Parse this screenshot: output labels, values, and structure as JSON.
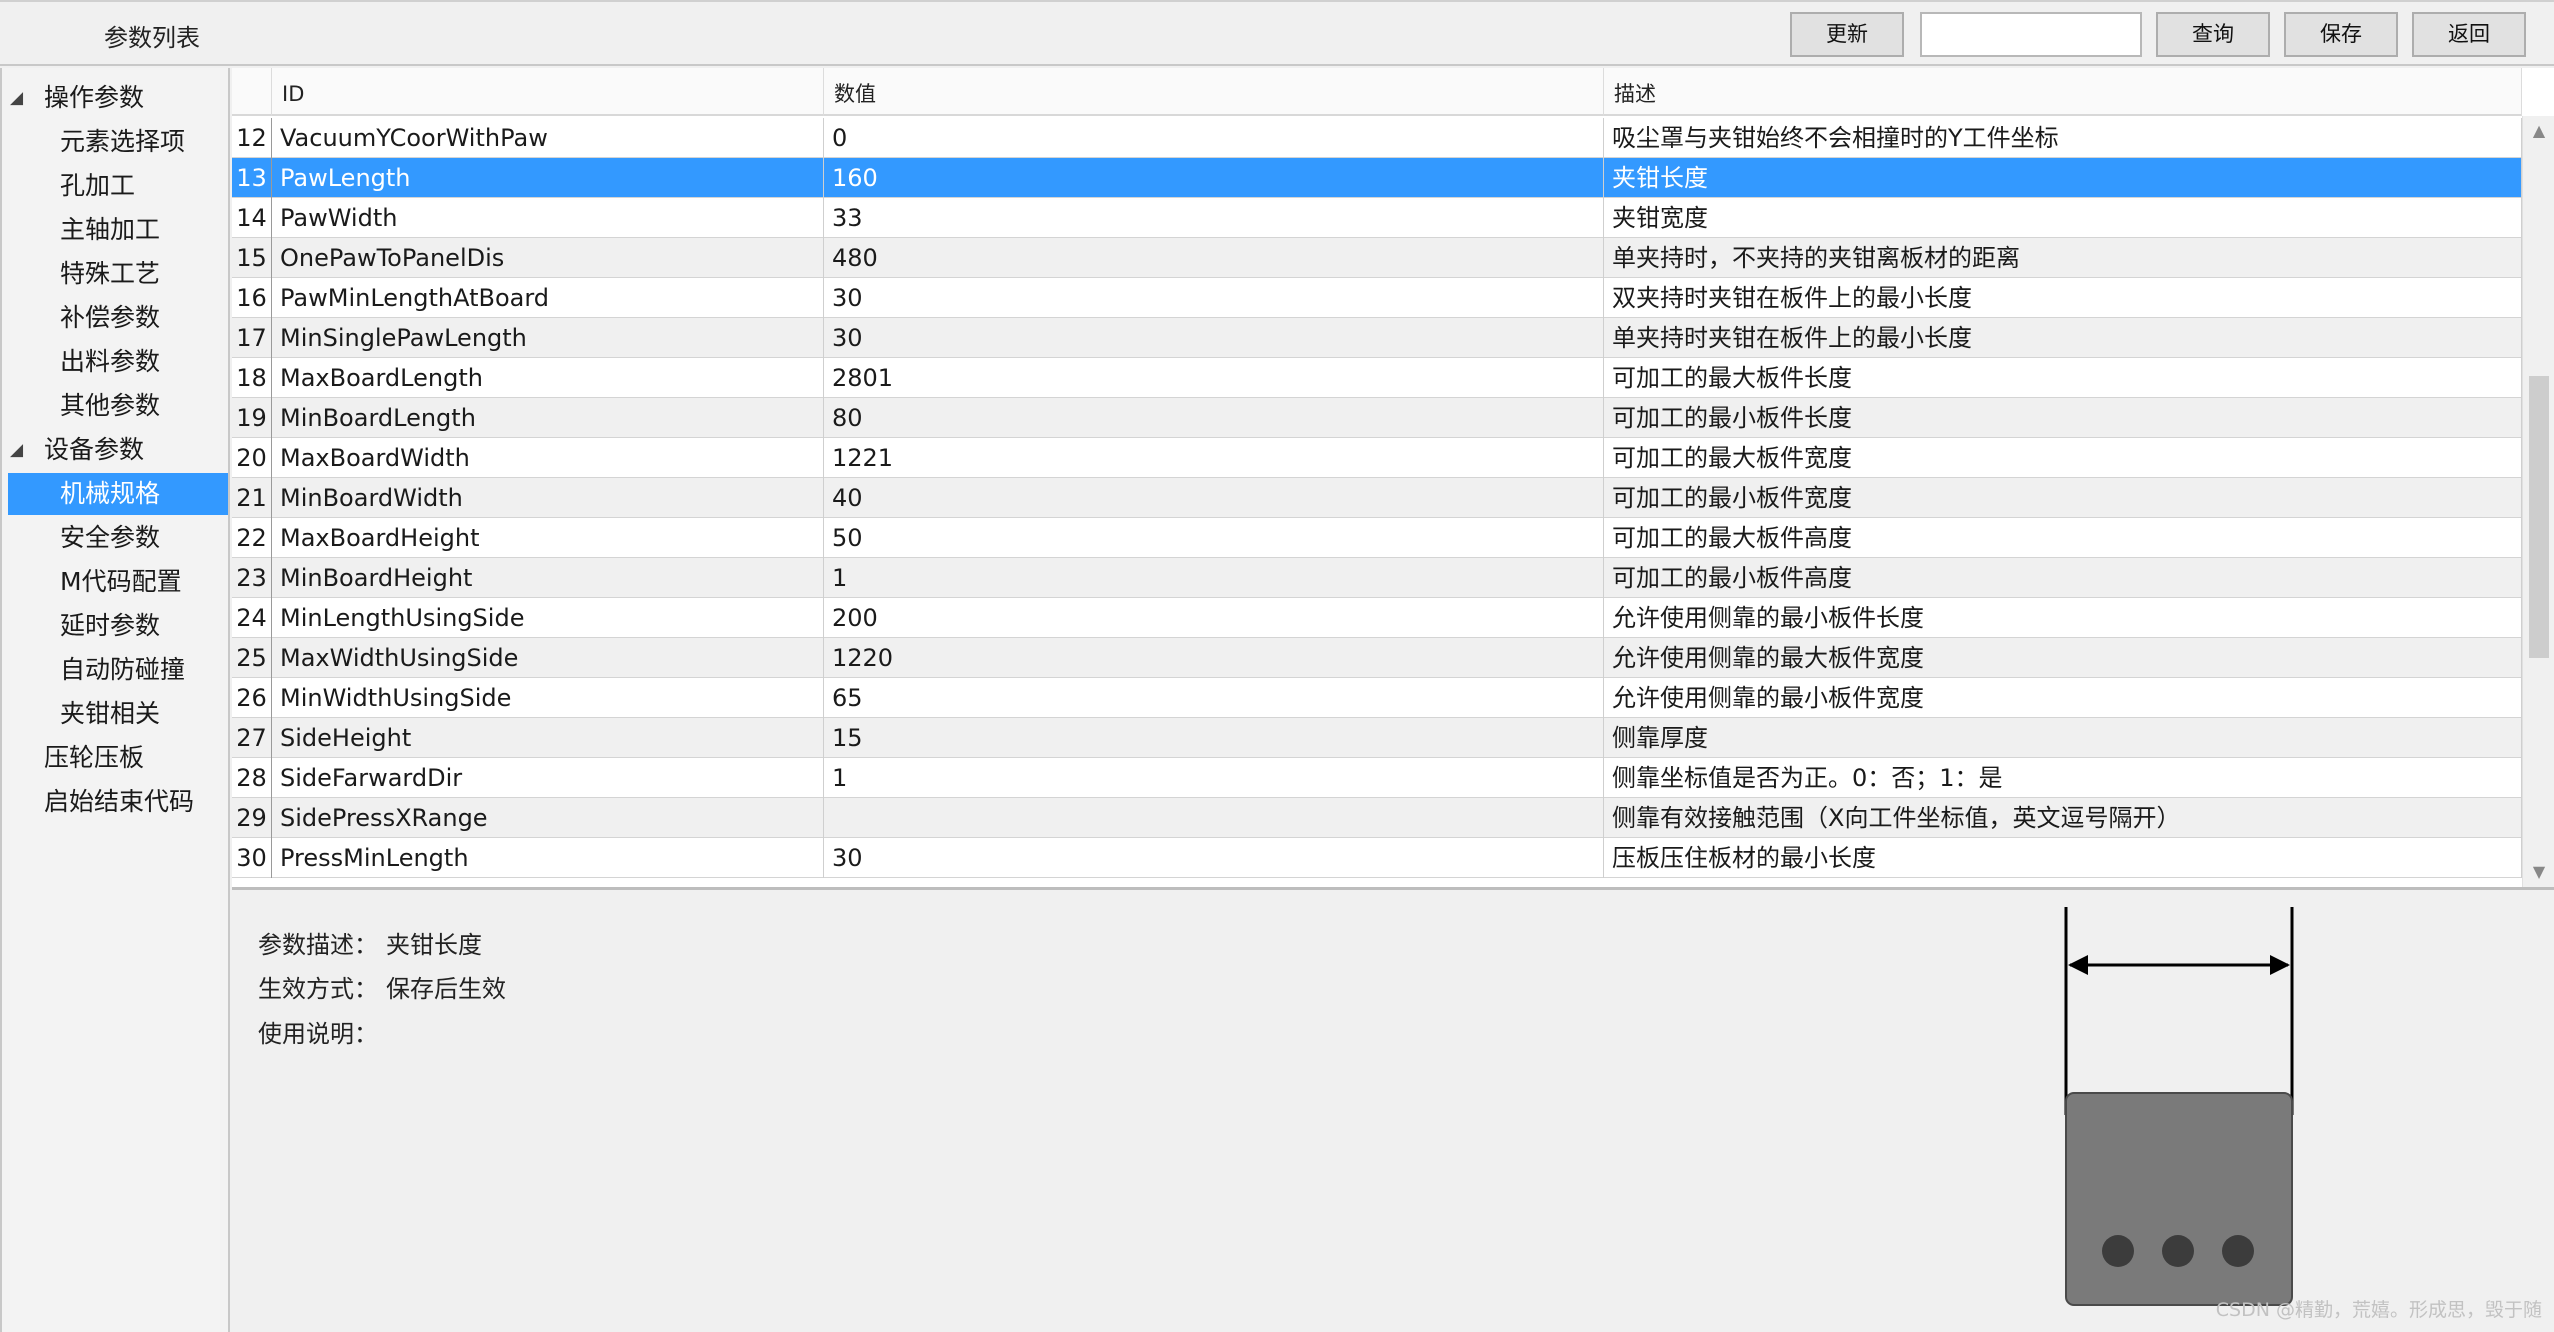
{
  "header": {
    "title": "参数列表",
    "buttons": {
      "refresh": "更新",
      "query": "查询",
      "save": "保存",
      "back": "返回"
    },
    "search_value": ""
  },
  "sidebar": {
    "items": [
      {
        "label": "操作参数",
        "kind": "group"
      },
      {
        "label": "元素选择项",
        "kind": "child"
      },
      {
        "label": "孔加工",
        "kind": "child"
      },
      {
        "label": "主轴加工",
        "kind": "child"
      },
      {
        "label": "特殊工艺",
        "kind": "child"
      },
      {
        "label": "补偿参数",
        "kind": "child"
      },
      {
        "label": "出料参数",
        "kind": "child"
      },
      {
        "label": "其他参数",
        "kind": "child"
      },
      {
        "label": "设备参数",
        "kind": "group"
      },
      {
        "label": "机械规格",
        "kind": "child",
        "selected": true
      },
      {
        "label": "安全参数",
        "kind": "child"
      },
      {
        "label": "M代码配置",
        "kind": "child"
      },
      {
        "label": "延时参数",
        "kind": "child"
      },
      {
        "label": "自动防碰撞",
        "kind": "child"
      },
      {
        "label": "夹钳相关",
        "kind": "child"
      },
      {
        "label": "压轮压板",
        "kind": "top"
      },
      {
        "label": "启始结束代码",
        "kind": "top"
      }
    ]
  },
  "grid": {
    "columns": [
      "ID",
      "数值",
      "描述"
    ],
    "selected_index": "13",
    "rows": [
      {
        "index": "12",
        "id": "VacuumYCoorWithPaw",
        "value": "0",
        "desc": "吸尘罩与夹钳始终不会相撞时的Y工件坐标"
      },
      {
        "index": "13",
        "id": "PawLength",
        "value": "160",
        "desc": "夹钳长度"
      },
      {
        "index": "14",
        "id": "PawWidth",
        "value": "33",
        "desc": "夹钳宽度"
      },
      {
        "index": "15",
        "id": "OnePawToPanelDis",
        "value": "480",
        "desc": "单夹持时，不夹持的夹钳离板材的距离"
      },
      {
        "index": "16",
        "id": "PawMinLengthAtBoard",
        "value": "30",
        "desc": "双夹持时夹钳在板件上的最小长度"
      },
      {
        "index": "17",
        "id": "MinSinglePawLength",
        "value": "30",
        "desc": "单夹持时夹钳在板件上的最小长度"
      },
      {
        "index": "18",
        "id": "MaxBoardLength",
        "value": "2801",
        "desc": "可加工的最大板件长度"
      },
      {
        "index": "19",
        "id": "MinBoardLength",
        "value": "80",
        "desc": "可加工的最小板件长度"
      },
      {
        "index": "20",
        "id": "MaxBoardWidth",
        "value": "1221",
        "desc": "可加工的最大板件宽度"
      },
      {
        "index": "21",
        "id": "MinBoardWidth",
        "value": "40",
        "desc": "可加工的最小板件宽度"
      },
      {
        "index": "22",
        "id": "MaxBoardHeight",
        "value": "50",
        "desc": "可加工的最大板件高度"
      },
      {
        "index": "23",
        "id": "MinBoardHeight",
        "value": "1",
        "desc": "可加工的最小板件高度"
      },
      {
        "index": "24",
        "id": "MinLengthUsingSide",
        "value": "200",
        "desc": "允许使用侧靠的最小板件长度"
      },
      {
        "index": "25",
        "id": "MaxWidthUsingSide",
        "value": "1220",
        "desc": "允许使用侧靠的最大板件宽度"
      },
      {
        "index": "26",
        "id": "MinWidthUsingSide",
        "value": "65",
        "desc": "允许使用侧靠的最小板件宽度"
      },
      {
        "index": "27",
        "id": "SideHeight",
        "value": "15",
        "desc": "侧靠厚度"
      },
      {
        "index": "28",
        "id": "SideFarwardDir",
        "value": "1",
        "desc": "侧靠坐标值是否为正。0：否；1：是"
      },
      {
        "index": "29",
        "id": "SidePressXRange",
        "value": "",
        "desc": "侧靠有效接触范围（X向工件坐标值，英文逗号隔开）"
      },
      {
        "index": "30",
        "id": "PressMinLength",
        "value": "30",
        "desc": "压板压住板材的最小长度"
      }
    ]
  },
  "detail": {
    "desc_label": "参数描述：",
    "desc_value": "夹钳长度",
    "effect_label": "生效方式：",
    "effect_value": "保存后生效",
    "usage_label": "使用说明：",
    "usage_value": ""
  },
  "watermark": "CSDN @精勤，荒嬉。形成思，毁于随",
  "colors": {
    "selection": "#3399ff",
    "diagram_fill": "#7a7a7a",
    "hole": "#3c3c3c"
  }
}
